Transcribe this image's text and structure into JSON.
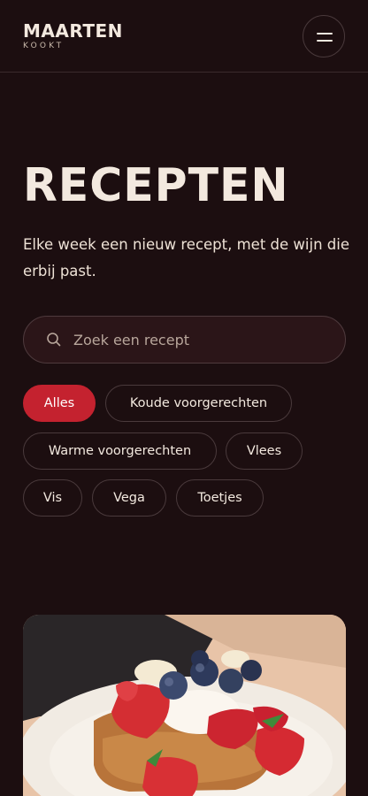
{
  "header": {
    "logo_main": "MAARTEN",
    "logo_sub": "KOOKT",
    "menu_icon": "hamburger-menu-icon"
  },
  "hero": {
    "title": "RECEPTEN",
    "intro": "Elke week een nieuw recept, met de wijn die erbij past."
  },
  "search": {
    "placeholder": "Zoek een recept",
    "value": "",
    "icon": "search-icon"
  },
  "filters": [
    {
      "label": "Alles",
      "active": true
    },
    {
      "label": "Koude voorgerechten",
      "active": false
    },
    {
      "label": "Warme voorgerechten",
      "active": false
    },
    {
      "label": "Vlees",
      "active": false
    },
    {
      "label": "Vis",
      "active": false
    },
    {
      "label": "Vega",
      "active": false
    },
    {
      "label": "Toetjes",
      "active": false
    }
  ],
  "colors": {
    "background": "#1c0e10",
    "accent": "#c4222f",
    "text": "#f3e9df"
  }
}
